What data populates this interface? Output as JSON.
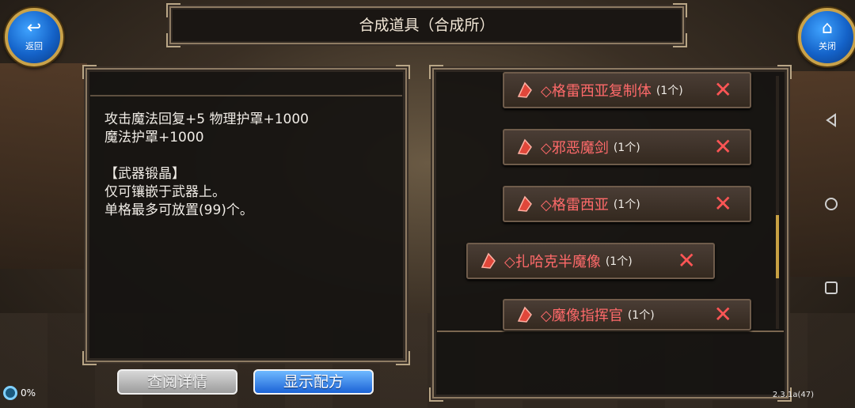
{
  "header": {
    "title": "合成道具（合成所）",
    "back": {
      "label": "返回",
      "icon": "return-arrow-icon"
    },
    "close": {
      "label": "关闭",
      "icon": "home-icon"
    }
  },
  "description": {
    "lines": "攻击魔法回复+5 物理护罩+1000\n魔法护罩+1000\n\n【武器锻晶】\n仅可镶嵌于武器上。\n单格最多可放置(99)个。"
  },
  "materials": [
    {
      "name": "◇格雷西亚复制体",
      "count": "(1个)"
    },
    {
      "name": "◇邪恶魔剑",
      "count": "(1个)"
    },
    {
      "name": "◇格雷西亚",
      "count": "(1个)"
    },
    {
      "name": "◇扎哈克半魔像",
      "count": "(1个)"
    },
    {
      "name": "◇魔像指挥官",
      "count": "(1个)"
    }
  ],
  "buttons": {
    "view_details": "查阅详情",
    "show_recipe": "显示配方"
  },
  "status": {
    "battery": "0%",
    "version": "2.3.1a(47)"
  },
  "colors": {
    "accent_blue": "#1b63d6",
    "item_name": "#ff6a6a",
    "gold": "#c9a24a"
  }
}
